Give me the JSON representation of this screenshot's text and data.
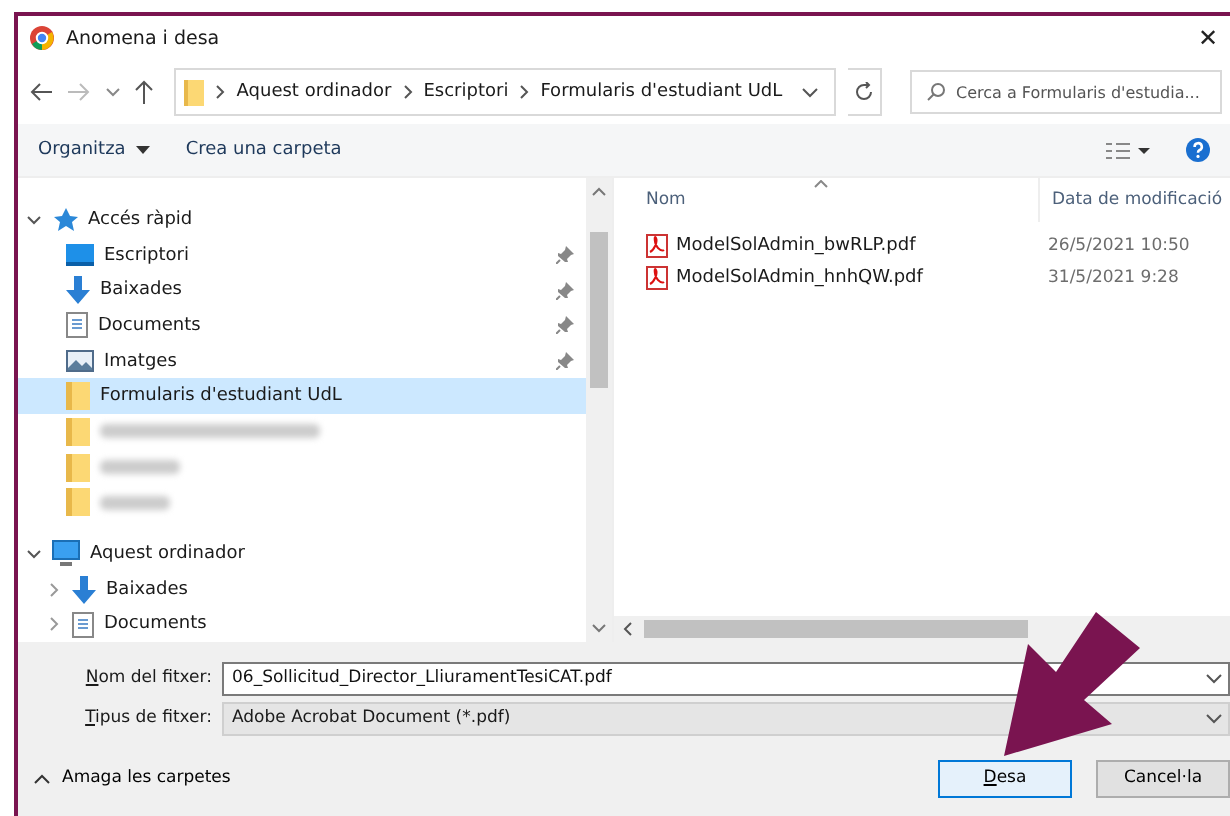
{
  "window": {
    "title": "Anomena i desa",
    "close": "✕"
  },
  "navigation": {
    "breadcrumb": [
      "Aquest ordinador",
      "Escriptori",
      "Formularis d'estudiant UdL"
    ],
    "search": {
      "placeholder": "Cerca a Formularis d'estudia..."
    }
  },
  "toolbar": {
    "organize": "Organitza",
    "new_folder": "Crea una carpeta"
  },
  "sidebar": {
    "tree": [
      {
        "label": "Accés ràpid",
        "kind": "star",
        "expanded": true,
        "children": [
          {
            "label": "Escriptori",
            "kind": "desktop",
            "pinned": true,
            "selected": false
          },
          {
            "label": "Baixades",
            "kind": "download",
            "pinned": true,
            "selected": false
          },
          {
            "label": "Documents",
            "kind": "document",
            "pinned": true,
            "selected": false
          },
          {
            "label": "Imatges",
            "kind": "image",
            "pinned": true,
            "selected": false
          },
          {
            "label": "Formularis d'estudiant UdL",
            "kind": "folder",
            "pinned": false,
            "selected": true
          },
          {
            "kind": "folder",
            "redacted": true,
            "pinned": false,
            "selected": false
          },
          {
            "kind": "folder",
            "redacted": true,
            "pinned": false,
            "selected": false
          },
          {
            "kind": "folder",
            "redacted": true,
            "pinned": false,
            "selected": false
          }
        ]
      },
      {
        "label": "Aquest ordinador",
        "kind": "computer",
        "expanded": true,
        "children": [
          {
            "label": "Baixades",
            "kind": "download",
            "expanded": false,
            "selected": false
          },
          {
            "label": "Documents",
            "kind": "document",
            "expanded": false,
            "selected": false
          }
        ]
      }
    ]
  },
  "files": {
    "columns": [
      "Nom",
      "Data de modificació"
    ],
    "rows": [
      {
        "name": "ModelSolAdmin_bwRLP.pdf",
        "modified": "26/5/2021 10:50"
      },
      {
        "name": "ModelSolAdmin_hnhQW.pdf",
        "modified": "31/5/2021 9:28"
      }
    ]
  },
  "form": {
    "filename_label": "Nom del fitxer:",
    "filename": "06_Sollicitud_Director_LliuramentTesiCAT.pdf",
    "type_label": "Tipus de fitxer:",
    "type": "Adobe Acrobat Document (*.pdf)"
  },
  "footer": {
    "hide_folders": "Amaga les carpetes",
    "buttons": [
      {
        "label": "Desa",
        "kind": "primary"
      },
      {
        "label": "Cancel·la",
        "kind": "normal"
      }
    ]
  }
}
